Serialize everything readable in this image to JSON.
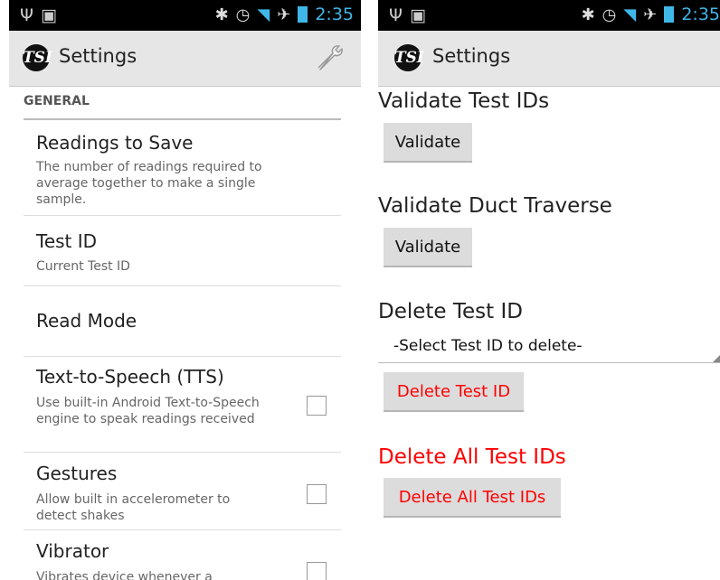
{
  "status_bar": {
    "time": "2:35",
    "icons": [
      "usb-icon",
      "android-debug-icon",
      "bluetooth-icon",
      "alarm-icon",
      "wifi-icon",
      "airplane-icon",
      "battery-charging-icon"
    ]
  },
  "left_screen": {
    "action_bar": {
      "logo_text": "TSI",
      "title": "Settings",
      "action_icon": "wrench-icon"
    },
    "section_header": "GENERAL",
    "prefs": [
      {
        "title": "Readings to Save",
        "summary": "The number of readings required to average together to make a single sample."
      },
      {
        "title": "Test ID",
        "summary": "Current Test ID"
      },
      {
        "title": "Read Mode",
        "summary": ""
      },
      {
        "title": "Text-to-Speech (TTS)",
        "summary": "Use built-in Android Text-to-Speech engine to speak readings received",
        "checked": false
      },
      {
        "title": "Gestures",
        "summary": "Allow built in accelerometer to detect shakes",
        "checked": false
      },
      {
        "title": "Vibrator",
        "summary": "Vibrates device whenever a",
        "checked": false
      }
    ]
  },
  "right_screen": {
    "action_bar": {
      "logo_text": "TSI",
      "title": "Settings"
    },
    "validate_test_ids": {
      "heading": "Validate Test IDs",
      "button": "Validate"
    },
    "validate_duct_traverse": {
      "heading": "Validate Duct Traverse",
      "button": "Validate"
    },
    "delete_test_id": {
      "heading": "Delete Test ID",
      "spinner_value": "-Select Test ID to delete-",
      "button": "Delete Test ID"
    },
    "delete_all": {
      "heading": "Delete All Test IDs",
      "button": "Delete All Test IDs"
    }
  },
  "colors": {
    "accent": "#33b5e5",
    "danger": "#ff0000",
    "action_bar_bg": "#e6e6e6"
  }
}
